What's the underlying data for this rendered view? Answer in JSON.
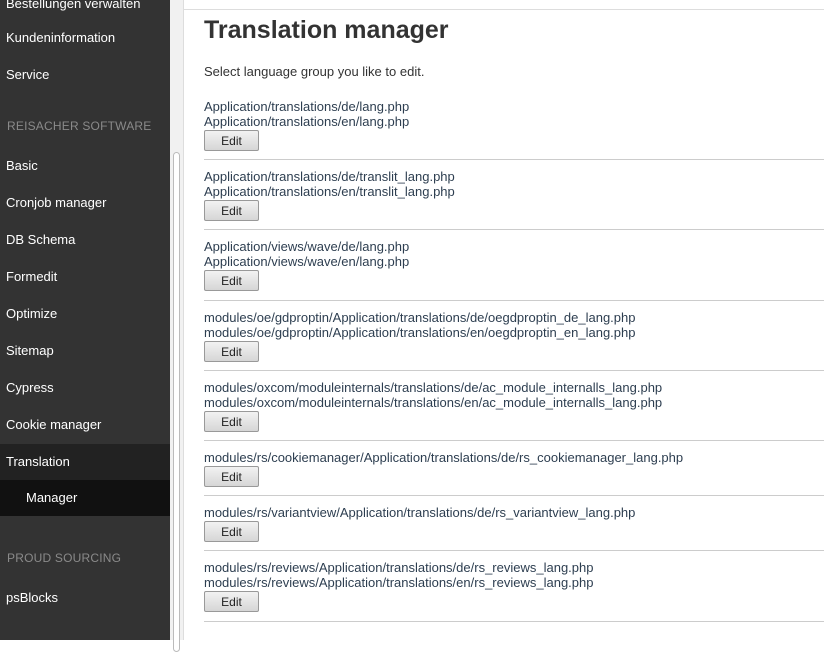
{
  "sidebar": {
    "partial_top_item": "Bestellungen verwalten",
    "items_before": [
      {
        "label": "Kundeninformation"
      },
      {
        "label": "Service"
      }
    ],
    "section_reisacher": "REISACHER SOFTWARE",
    "items_reisacher": [
      {
        "label": "Basic"
      },
      {
        "label": "Cronjob manager"
      },
      {
        "label": "DB Schema"
      },
      {
        "label": "Formedit"
      },
      {
        "label": "Optimize"
      },
      {
        "label": "Sitemap"
      },
      {
        "label": "Cypress"
      },
      {
        "label": "Cookie manager"
      },
      {
        "label": "Translation"
      }
    ],
    "sub_item": "Manager",
    "section_proud": "PROUD SOURCING",
    "items_proud": [
      {
        "label": "psBlocks"
      }
    ]
  },
  "main": {
    "title": "Translation manager",
    "intro": "Select language group you like to edit.",
    "edit_label": "Edit",
    "groups": [
      {
        "files": [
          "Application/translations/de/lang.php",
          "Application/translations/en/lang.php"
        ]
      },
      {
        "files": [
          "Application/translations/de/translit_lang.php",
          "Application/translations/en/translit_lang.php"
        ]
      },
      {
        "files": [
          "Application/views/wave/de/lang.php",
          "Application/views/wave/en/lang.php"
        ]
      },
      {
        "files": [
          "modules/oe/gdproptin/Application/translations/de/oegdproptin_de_lang.php",
          "modules/oe/gdproptin/Application/translations/en/oegdproptin_en_lang.php"
        ]
      },
      {
        "files": [
          "modules/oxcom/moduleinternals/translations/de/ac_module_internalls_lang.php",
          "modules/oxcom/moduleinternals/translations/en/ac_module_internalls_lang.php"
        ]
      },
      {
        "files": [
          "modules/rs/cookiemanager/Application/translations/de/rs_cookiemanager_lang.php"
        ]
      },
      {
        "files": [
          "modules/rs/variantview/Application/translations/de/rs_variantview_lang.php"
        ]
      },
      {
        "files": [
          "modules/rs/reviews/Application/translations/de/rs_reviews_lang.php",
          "modules/rs/reviews/Application/translations/en/rs_reviews_lang.php"
        ]
      }
    ]
  }
}
